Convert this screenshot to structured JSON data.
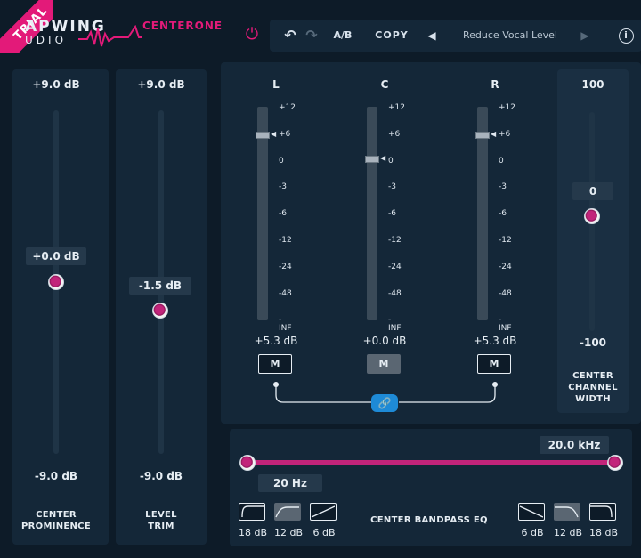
{
  "header": {
    "trial_badge": "TRIAL",
    "logo_main": "APWING",
    "logo_sub": "UDIO",
    "product": "CENTERONE",
    "toolbar": {
      "ab_label": "A/B",
      "copy_label": "COPY",
      "preset_name": "Reduce Vocal Level"
    }
  },
  "left_sliders": [
    {
      "top": "+9.0 dB",
      "value": "+0.0 dB",
      "bottom": "-9.0 dB",
      "label_1": "CENTER",
      "label_2": "PROMINENCE"
    },
    {
      "top": "+9.0 dB",
      "value": "-1.5 dB",
      "bottom": "-9.0 dB",
      "label_1": "LEVEL",
      "label_2": "TRIM"
    }
  ],
  "channels": [
    {
      "name": "L",
      "gain": "+5.3 dB",
      "mute": "M"
    },
    {
      "name": "C",
      "gain": "+0.0 dB",
      "mute": "M"
    },
    {
      "name": "R",
      "gain": "+5.3 dB",
      "mute": "M"
    }
  ],
  "meter_scale": [
    "+12",
    "+6",
    "0",
    "-3",
    "-6",
    "-12",
    "-24",
    "-48",
    "-INF"
  ],
  "width_slider": {
    "top": "100",
    "value": "0",
    "bottom": "-100",
    "label_1": "CENTER",
    "label_2": "CHANNEL",
    "label_3": "WIDTH"
  },
  "eq": {
    "high_value": "20.0 kHz",
    "low_value": "20 Hz",
    "title": "CENTER BANDPASS EQ",
    "low_slopes": [
      "18 dB",
      "12 dB",
      "6 dB"
    ],
    "high_slopes": [
      "6 dB",
      "12 dB",
      "18 dB"
    ]
  },
  "colors": {
    "accent": "#e31a79",
    "panel": "#142738",
    "background": "#0d1b28"
  }
}
